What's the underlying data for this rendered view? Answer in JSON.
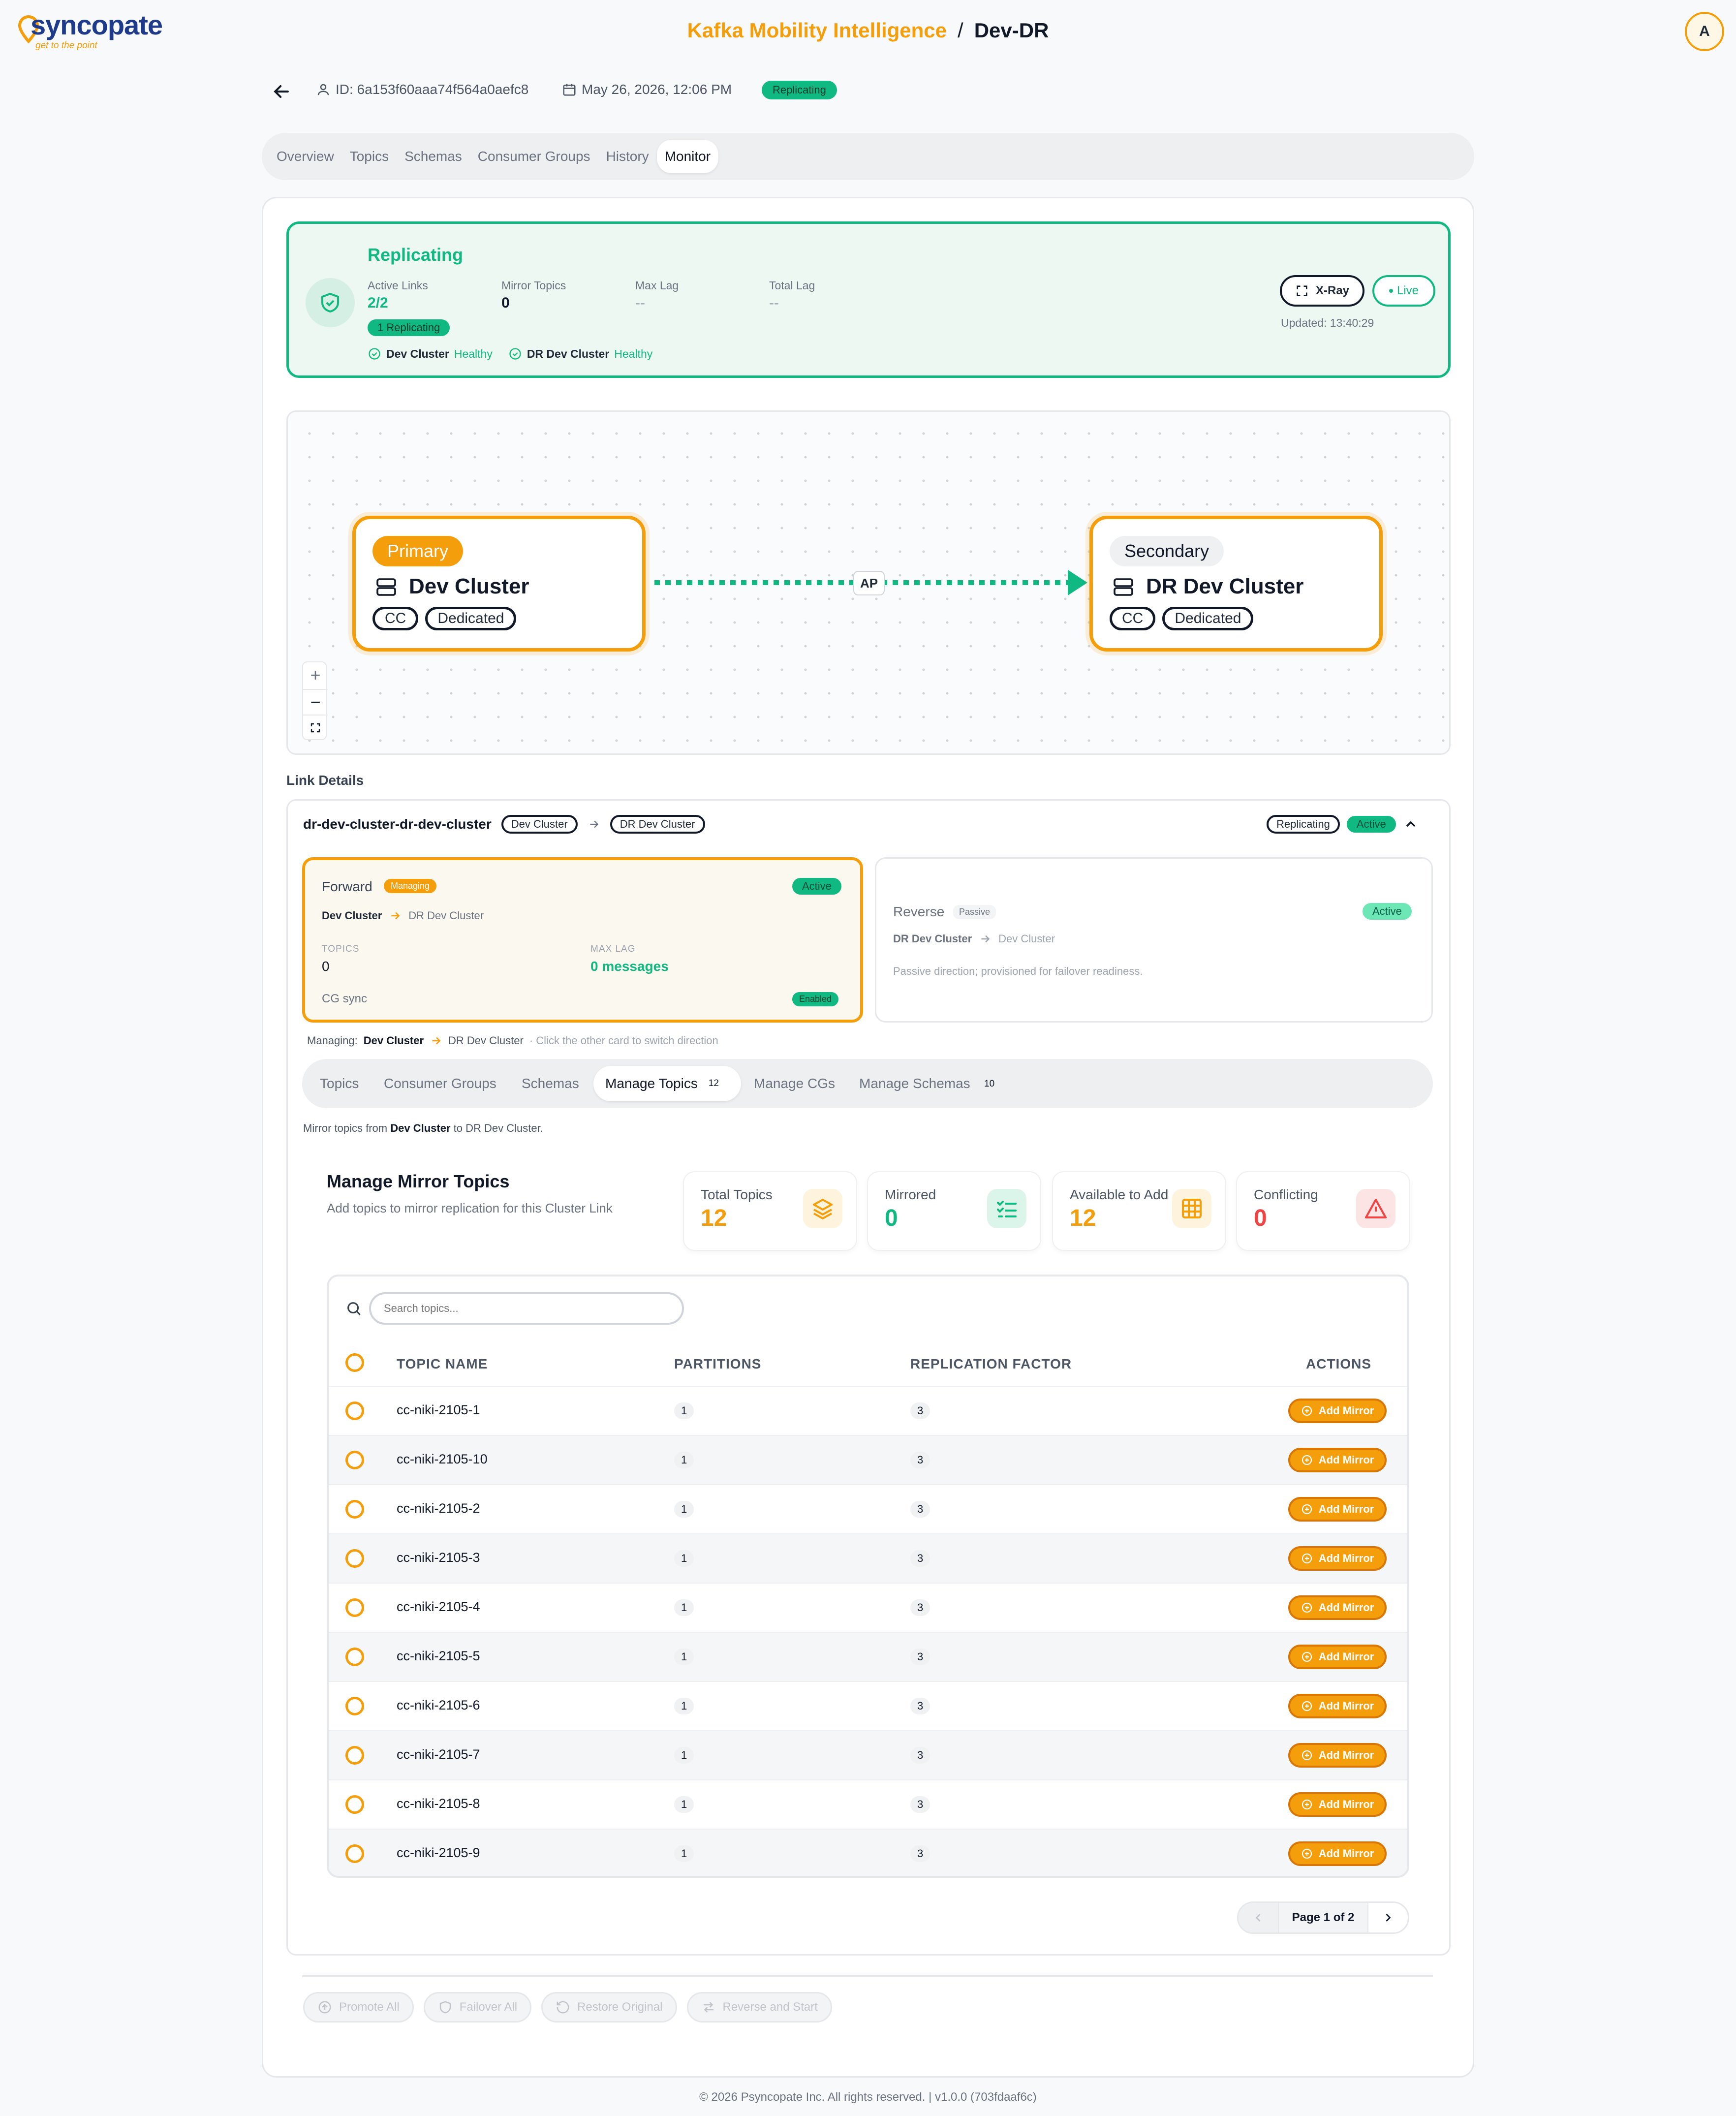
{
  "brand": {
    "logo": "syncopate",
    "tagline": "get to the point"
  },
  "header": {
    "project": "Kafka Mobility Intelligence",
    "separator": "/",
    "page": "Dev-DR",
    "avatar_initial": "A"
  },
  "meta": {
    "id": "ID: 6a153f60aaa74f564a0aefc8",
    "date": "May 26, 2026, 12:06 PM",
    "status": "Replicating"
  },
  "tabs": [
    "Overview",
    "Topics",
    "Schemas",
    "Consumer Groups",
    "History",
    "Monitor"
  ],
  "active_tab": "Monitor",
  "status_card": {
    "title": "Replicating",
    "active_links_label": "Active Links",
    "active_links_value": "2/2",
    "mirror_topics_label": "Mirror Topics",
    "mirror_topics_value": "0",
    "max_lag_label": "Max Lag",
    "max_lag_value": "--",
    "total_lag_label": "Total Lag",
    "total_lag_value": "--",
    "replicating_badge": "1 Replicating",
    "cluster1_name": "Dev Cluster",
    "cluster1_state": "Healthy",
    "cluster2_name": "DR Dev Cluster",
    "cluster2_state": "Healthy",
    "xray_label": "X-Ray",
    "live_label": "Live",
    "updated": "Updated: 13:40:29"
  },
  "topology": {
    "primary": {
      "role": "Primary",
      "name": "Dev Cluster",
      "chips": [
        "CC",
        "Dedicated"
      ]
    },
    "secondary": {
      "role": "Secondary",
      "name": "DR Dev Cluster",
      "chips": [
        "CC",
        "Dedicated"
      ]
    },
    "edge_label": "AP",
    "zoom_in": "+",
    "zoom_out": "−"
  },
  "link_details": {
    "heading": "Link Details",
    "link_name": "dr-dev-cluster-dr-dev-cluster",
    "source": "Dev Cluster",
    "target": "DR Dev Cluster",
    "status": "Replicating",
    "state": "Active",
    "forward": {
      "title": "Forward",
      "badge": "Managing",
      "state": "Active",
      "from": "Dev Cluster",
      "to": "DR Dev Cluster",
      "topics_label": "TOPICS",
      "topics_value": "0",
      "max_lag_label": "MAX LAG",
      "max_lag_value": "0 messages",
      "cg_sync_label": "CG sync",
      "cg_sync_value": "Enabled"
    },
    "reverse": {
      "title": "Reverse",
      "badge": "Passive",
      "state": "Active",
      "from": "DR Dev Cluster",
      "to": "Dev Cluster",
      "note": "Passive direction; provisioned for failover readiness."
    },
    "managing_label": "Managing:",
    "managing_from": "Dev Cluster",
    "managing_to": "DR Dev Cluster",
    "managing_hint": "· Click the other card to switch direction"
  },
  "sub_tabs": [
    {
      "label": "Topics"
    },
    {
      "label": "Consumer Groups"
    },
    {
      "label": "Schemas"
    },
    {
      "label": "Manage Topics",
      "count": "12"
    },
    {
      "label": "Manage CGs"
    },
    {
      "label": "Manage Schemas",
      "count": "10"
    }
  ],
  "mirror_desc": {
    "prefix": "Mirror topics from ",
    "from": "Dev Cluster",
    "mid": " to ",
    "to": "DR Dev Cluster",
    "suffix": "."
  },
  "manage": {
    "title": "Manage Mirror Topics",
    "subtitle": "Add topics to mirror replication for this Cluster Link",
    "stats": [
      {
        "label": "Total Topics",
        "value": "12",
        "color": "#f59e0b",
        "icon": "layers-icon"
      },
      {
        "label": "Mirrored",
        "value": "0",
        "color": "#10b981",
        "icon": "list-check-icon"
      },
      {
        "label": "Available to Add",
        "value": "12",
        "color": "#f59e0b",
        "icon": "grid-icon"
      },
      {
        "label": "Conflicting",
        "value": "0",
        "color": "#ef4444",
        "icon": "warning-icon"
      }
    ]
  },
  "table": {
    "search_placeholder": "Search topics...",
    "headers": [
      "TOPIC NAME",
      "PARTITIONS",
      "REPLICATION FACTOR",
      "ACTIONS"
    ],
    "action_label": "Add Mirror",
    "rows": [
      {
        "name": "cc-niki-2105-1",
        "partitions": "1",
        "rf": "3"
      },
      {
        "name": "cc-niki-2105-10",
        "partitions": "1",
        "rf": "3"
      },
      {
        "name": "cc-niki-2105-2",
        "partitions": "1",
        "rf": "3"
      },
      {
        "name": "cc-niki-2105-3",
        "partitions": "1",
        "rf": "3"
      },
      {
        "name": "cc-niki-2105-4",
        "partitions": "1",
        "rf": "3"
      },
      {
        "name": "cc-niki-2105-5",
        "partitions": "1",
        "rf": "3"
      },
      {
        "name": "cc-niki-2105-6",
        "partitions": "1",
        "rf": "3"
      },
      {
        "name": "cc-niki-2105-7",
        "partitions": "1",
        "rf": "3"
      },
      {
        "name": "cc-niki-2105-8",
        "partitions": "1",
        "rf": "3"
      },
      {
        "name": "cc-niki-2105-9",
        "partitions": "1",
        "rf": "3"
      }
    ],
    "pager": "Page 1 of 2"
  },
  "actions": [
    "Promote All",
    "Failover All",
    "Restore Original",
    "Reverse and Start"
  ],
  "footer": "© 2026 Psyncopate Inc. All rights reserved. | v1.0.0 (703fdaaf6c)",
  "colors": {
    "accent": "#f59e0b",
    "success": "#10b981",
    "danger": "#ef4444"
  }
}
